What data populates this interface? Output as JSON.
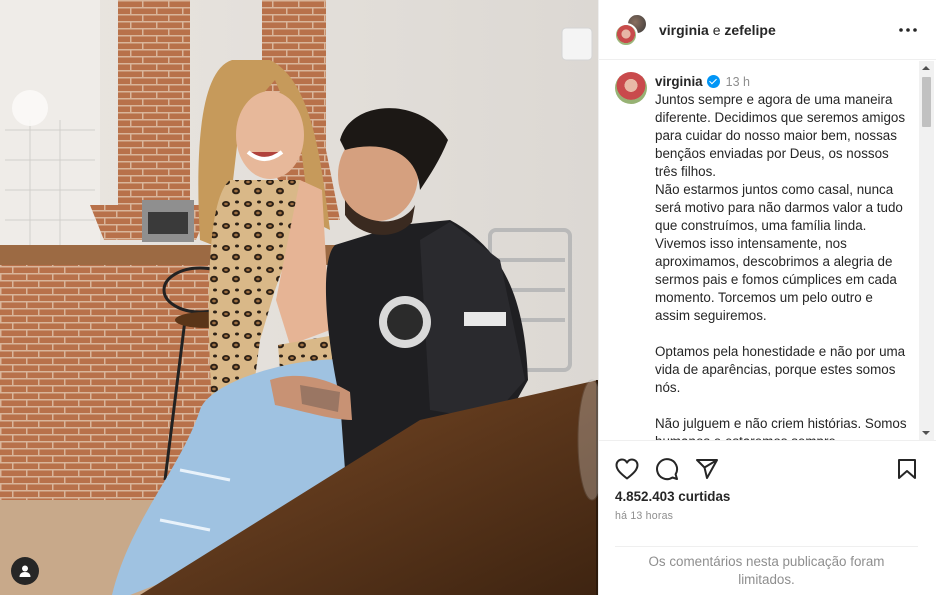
{
  "post": {
    "header": {
      "account_1": "virginia",
      "conjunction": "e",
      "account_2": "zefelipe"
    },
    "caption": {
      "username": "virginia",
      "time": "13 h",
      "paragraphs": [
        "Juntos sempre e agora de uma maneira diferente. Decidimos que seremos amigos para cuidar do nosso maior bem, nossas bençãos enviadas por Deus, os nossos três filhos.\nNão estarmos juntos como casal, nunca será motivo para não darmos valor a tudo que construímos, uma família linda. Vivemos isso intensamente, nos aproximamos, descobrimos a alegria de sermos pais e fomos cúmplices em cada momento. Torcemos um pelo outro e assim seguiremos.",
        "Optamos pela honestidade e não por uma vida de aparências, porque estes somos nós.",
        "Não julguem e não criem histórias. Somos humanos e estaremos sempre"
      ]
    },
    "likes": "4.852.403 curtidas",
    "posted_ago": "há 13 horas",
    "comments_notice": "Os comentários nesta publicação foram limitados."
  },
  "icons": {
    "more": "more-horizontal-icon",
    "like": "heart-icon",
    "comment": "comment-bubble-icon",
    "share": "paper-plane-icon",
    "save": "bookmark-icon",
    "tags": "user-tag-icon",
    "verified": "verified-badge-icon"
  },
  "colors": {
    "verified": "#0095f6",
    "text": "#262626",
    "secondary_text": "#8e8e8e",
    "border": "#efefef"
  }
}
